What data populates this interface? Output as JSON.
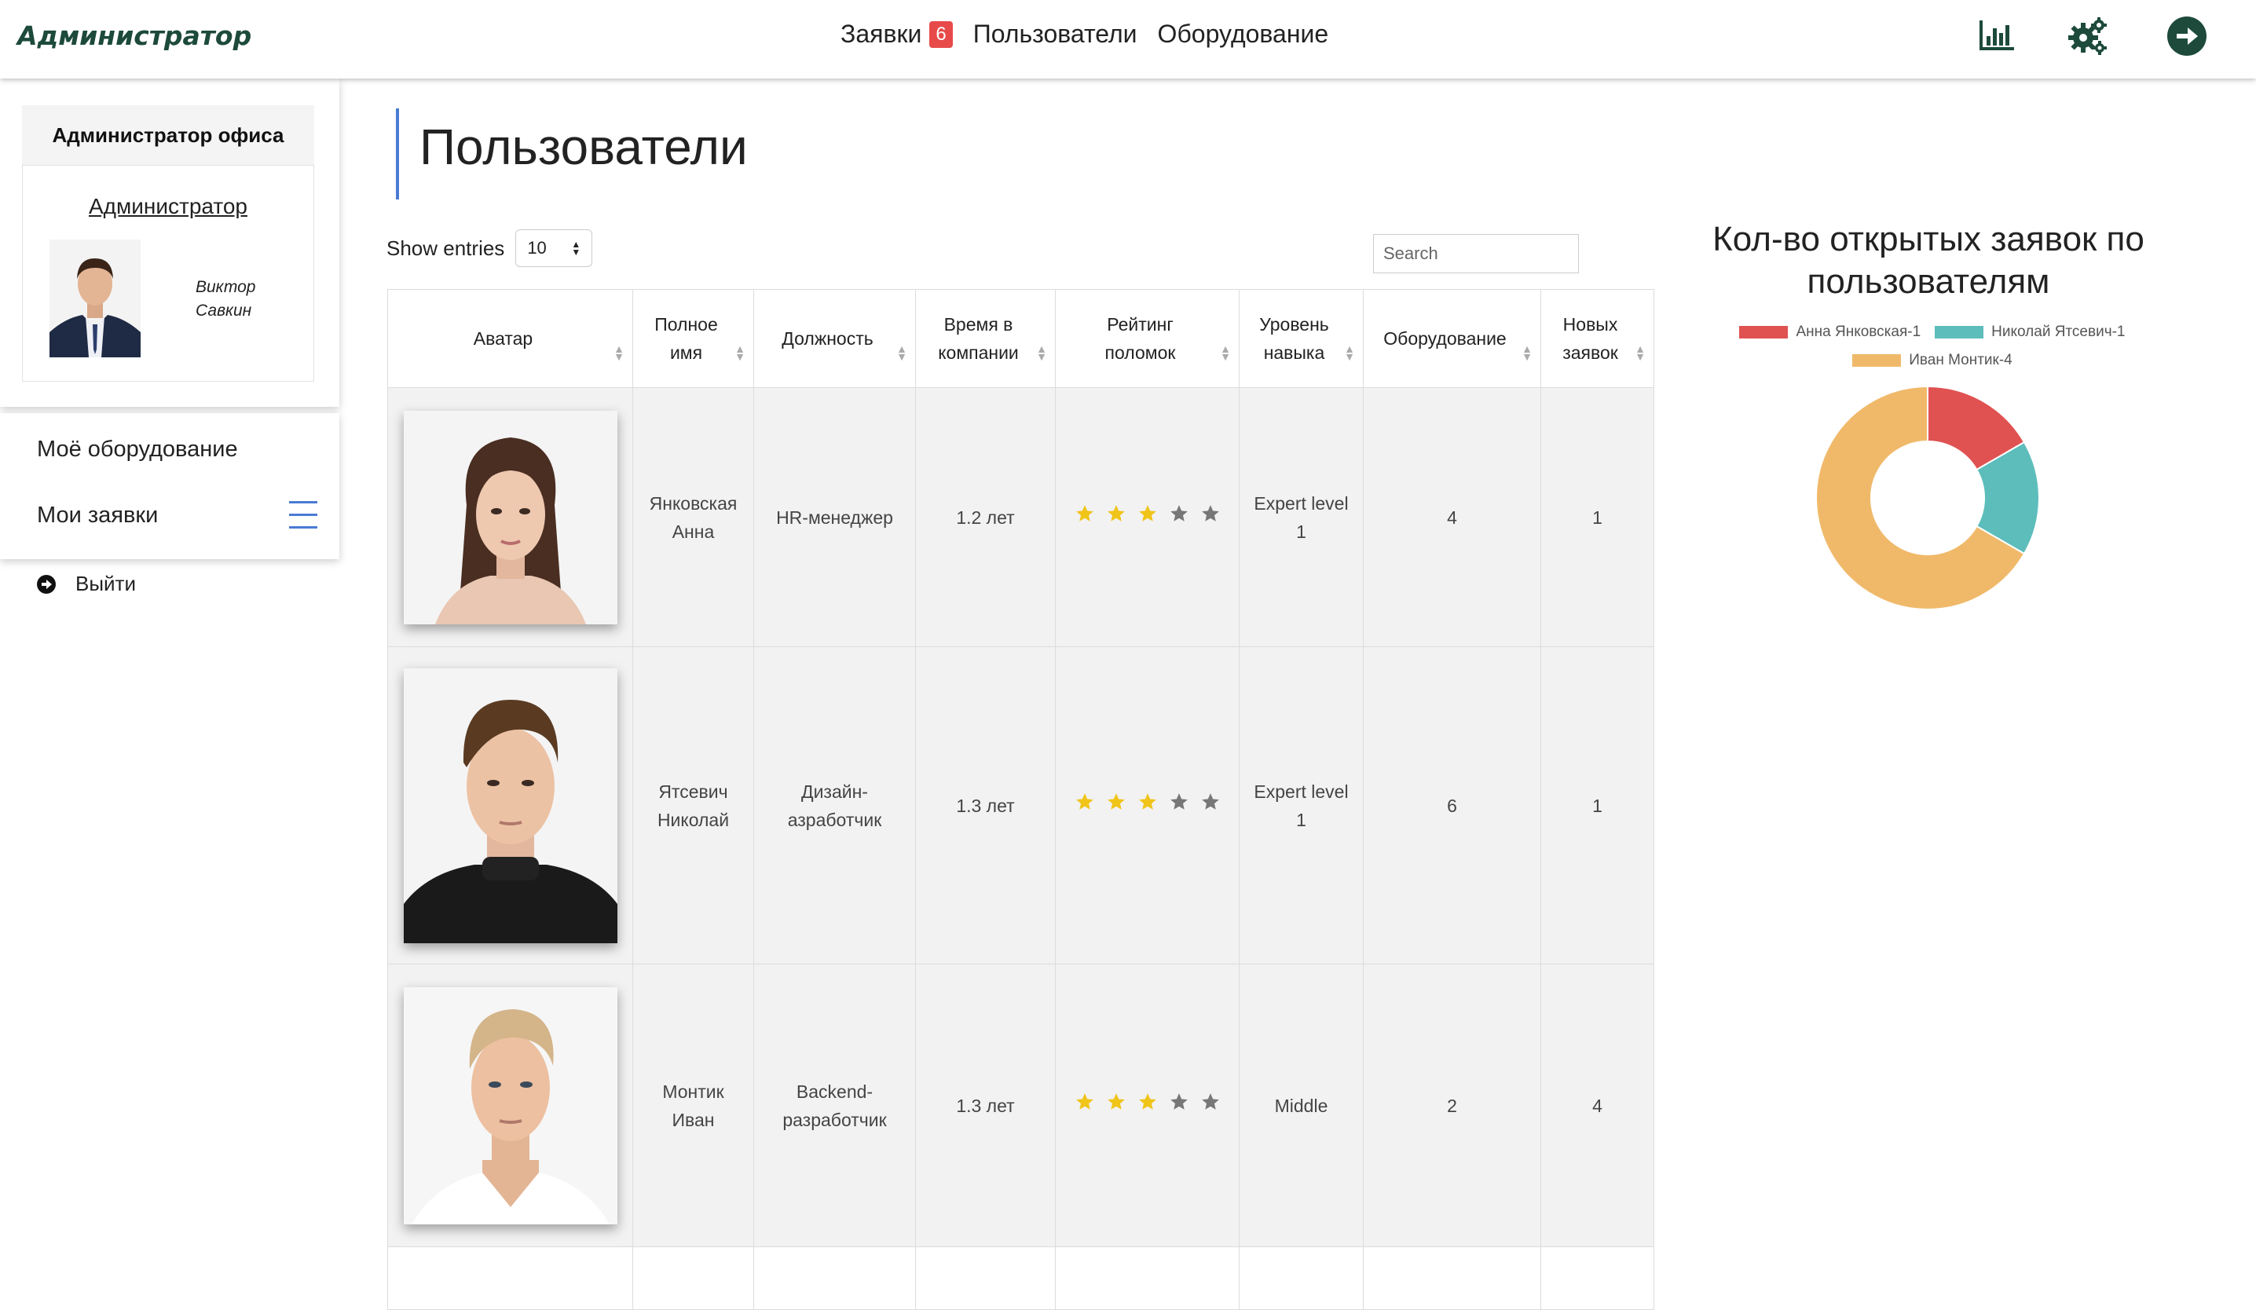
{
  "navbar": {
    "brand": "Администратор",
    "links": {
      "requests": "Заявки",
      "requests_badge": "6",
      "users": "Пользователи",
      "equipment": "Оборудование"
    },
    "icons": [
      "stats-icon",
      "settings-icon",
      "logout-arrow-icon"
    ],
    "accent_color": "#1d4a3a"
  },
  "sidebar": {
    "office_title": "Администратор офиса",
    "admin_link": "Администратор",
    "profile_name_line1": "Виктор",
    "profile_name_line2": "Савкин",
    "menu": {
      "my_equipment": "Моё оборудование",
      "my_requests": "Мои заявки"
    },
    "logout": "Выйти"
  },
  "main": {
    "title": "Пользователи",
    "show_entries_label": "Show entries",
    "entries_value": "10",
    "search_placeholder": "Search",
    "columns": {
      "avatar": "Аватар",
      "full_name": "Полное имя",
      "position": "Должность",
      "tenure": "Время в компании",
      "breakdown_rating": "Рейтинг поломок",
      "skill_level": "Уровень навыка",
      "equipment": "Оборудование",
      "new_requests": "Новых заявок"
    },
    "rows": [
      {
        "name_line1": "Янковская",
        "name_line2": "Анна",
        "position_line1": "HR-менеджер",
        "position_line2": "",
        "tenure": "1.2 лет",
        "rating": 3,
        "level_line1": "Expert level",
        "level_line2": "1",
        "equipment": "4",
        "new_requests": "1"
      },
      {
        "name_line1": "Ятсевич",
        "name_line2": "Николай",
        "position_line1": "Дизайн-",
        "position_line2": "азработчик",
        "tenure": "1.3 лет",
        "rating": 3,
        "level_line1": "Expert level",
        "level_line2": "1",
        "equipment": "6",
        "new_requests": "1"
      },
      {
        "name_line1": "Монтик",
        "name_line2": "Иван",
        "position_line1": "Backend-",
        "position_line2": "разработчик",
        "tenure": "1.3 лет",
        "rating": 3,
        "level_line1": "Middle",
        "level_line2": "",
        "equipment": "2",
        "new_requests": "4"
      }
    ],
    "star_colors": {
      "filled": "#f0c419",
      "empty": "#777777"
    }
  },
  "chart_data": {
    "type": "pie",
    "subtype": "doughnut",
    "title": "Кол-во открытых заявок по пользователям",
    "series": [
      {
        "name": "Анна Янковская-1",
        "value": 1,
        "color": "#e05252"
      },
      {
        "name": "Николай Ятсевич-1",
        "value": 1,
        "color": "#5dbdbb"
      },
      {
        "name": "Иван Монтик-4",
        "value": 4,
        "color": "#f0b96a"
      }
    ],
    "legend_position": "top"
  }
}
